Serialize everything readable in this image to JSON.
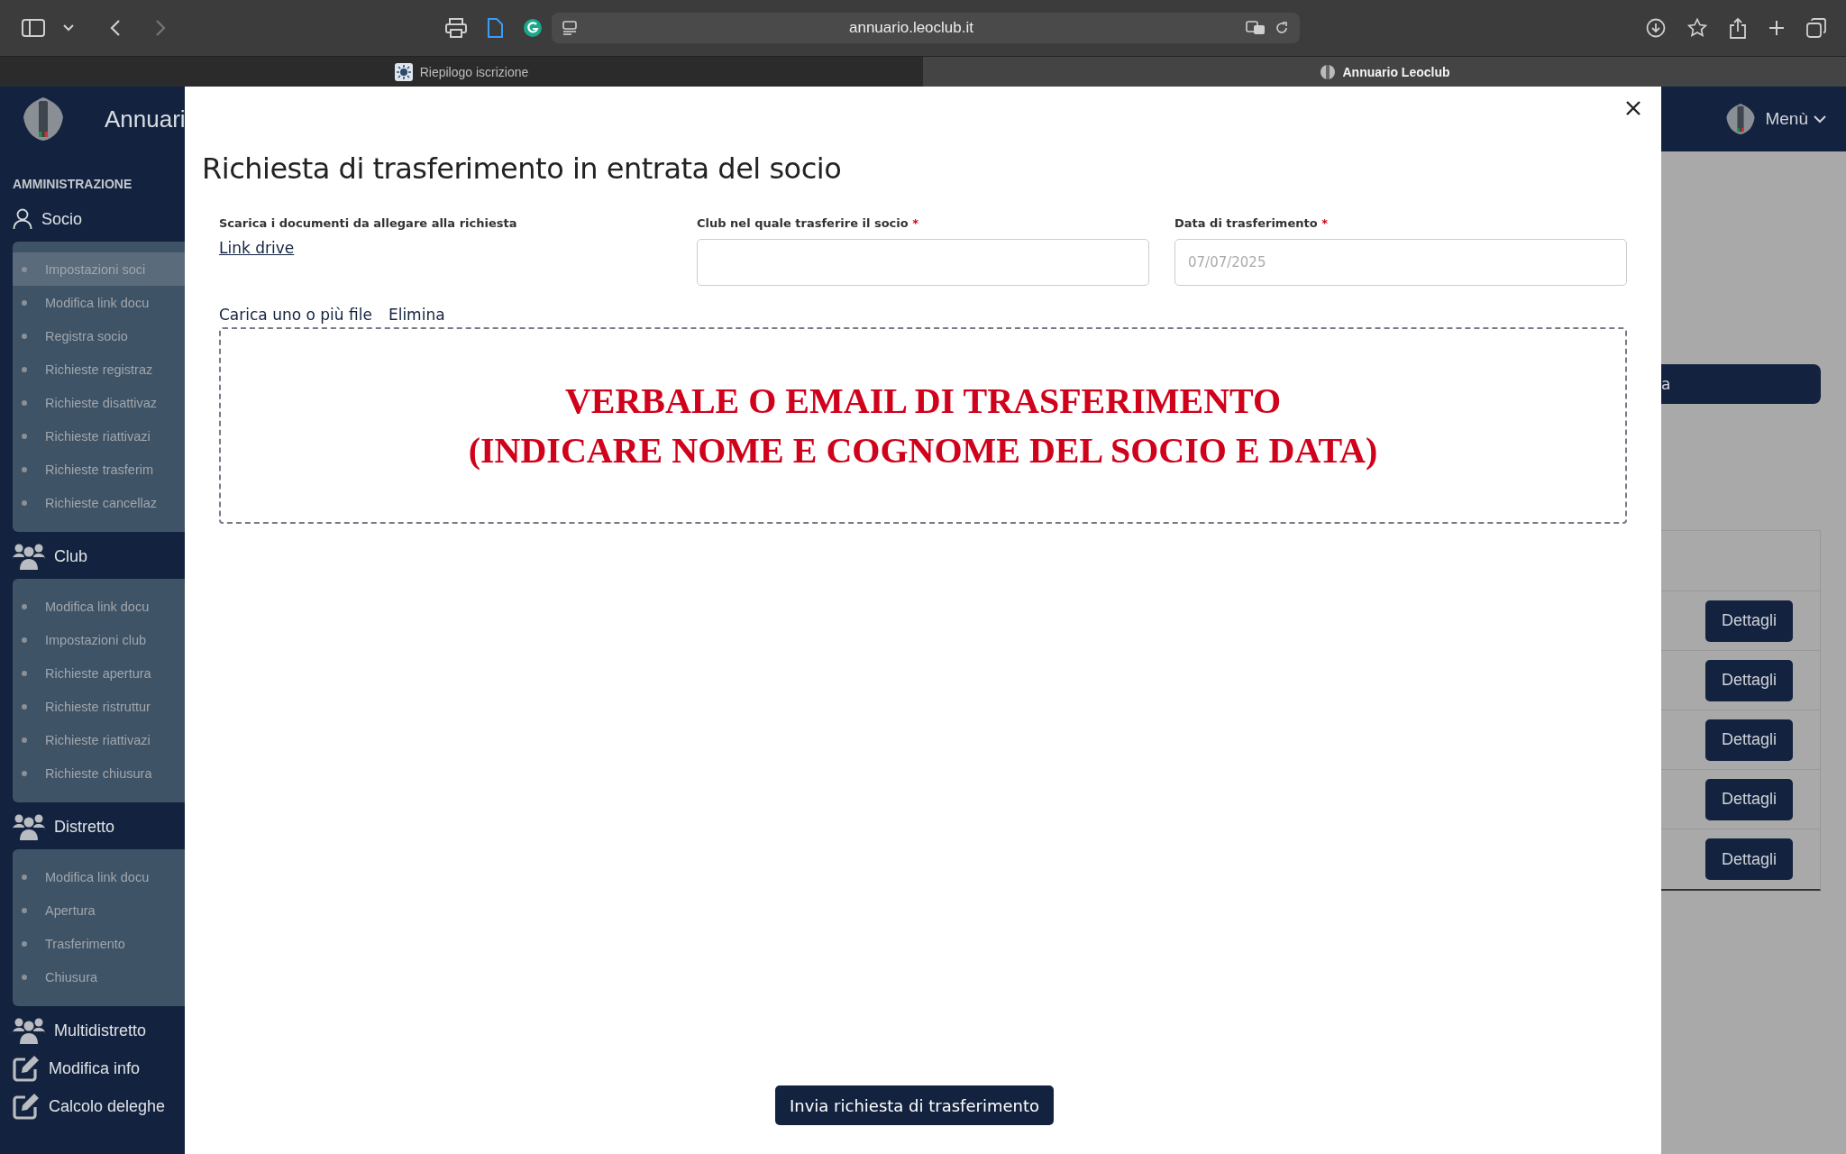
{
  "browser": {
    "url": "annuario.leoclub.it",
    "tabs": [
      {
        "label": "Riepilogo iscrizione",
        "selected": false
      },
      {
        "label": "Annuario Leoclub",
        "selected": true
      }
    ]
  },
  "app_header": {
    "title": "Annuari",
    "menu": "Menù"
  },
  "sidebar": {
    "section": "AMMINISTRAZIONE",
    "groups": [
      {
        "label": "Socio",
        "kind": "person",
        "items": [
          {
            "label": "Impostazioni soci",
            "selected": true
          },
          {
            "label": "Modifica link docu",
            "selected": false
          },
          {
            "label": "Registra socio",
            "selected": false
          },
          {
            "label": "Richieste registraz",
            "selected": false
          },
          {
            "label": "Richieste disattivaz",
            "selected": false
          },
          {
            "label": "Richieste riattivazi",
            "selected": false
          },
          {
            "label": "Richieste trasferim",
            "selected": false
          },
          {
            "label": "Richieste cancellaz",
            "selected": false
          }
        ]
      },
      {
        "label": "Club",
        "kind": "group",
        "items": [
          {
            "label": "Modifica link docu",
            "selected": false
          },
          {
            "label": "Impostazioni club",
            "selected": false
          },
          {
            "label": "Richieste apertura",
            "selected": false
          },
          {
            "label": "Richieste ristruttur",
            "selected": false
          },
          {
            "label": "Richieste riattivazi",
            "selected": false
          },
          {
            "label": "Richieste chiusura",
            "selected": false
          }
        ]
      },
      {
        "label": "Distretto",
        "kind": "group",
        "items": [
          {
            "label": "Modifica link docu",
            "selected": false
          },
          {
            "label": "Apertura",
            "selected": false
          },
          {
            "label": "Trasferimento",
            "selected": false
          },
          {
            "label": "Chiusura",
            "selected": false
          }
        ]
      },
      {
        "label": "Multidistretto",
        "kind": "group"
      },
      {
        "label": "Modifica info",
        "kind": "edit"
      },
      {
        "label": "Calcolo deleghe",
        "kind": "edit"
      }
    ]
  },
  "background": {
    "bar_text": "a",
    "row_buttons": [
      "Dettagli",
      "Dettagli",
      "Dettagli",
      "Dettagli",
      "Dettagli"
    ]
  },
  "modal": {
    "title": "Richiesta di trasferimento in entrata del socio",
    "documents": {
      "label": "Scarica i documenti da allegare alla richiesta",
      "link": "Link drive"
    },
    "club_field": {
      "label": "Club nel quale trasferire il socio",
      "required_mark": "*"
    },
    "date_field": {
      "label": "Data di trasferimento",
      "required_mark": "*",
      "value": "07/07/2025"
    },
    "upload": {
      "label": "Carica uno o più file",
      "delete": "Elimina"
    },
    "dropzone_lines": [
      "VERBALE O EMAIL DI TRASFERIMENTO",
      "(INDICARE NOME E COGNOME DEL SOCIO E DATA)"
    ],
    "submit": "Invia richiesta di trasferimento"
  }
}
